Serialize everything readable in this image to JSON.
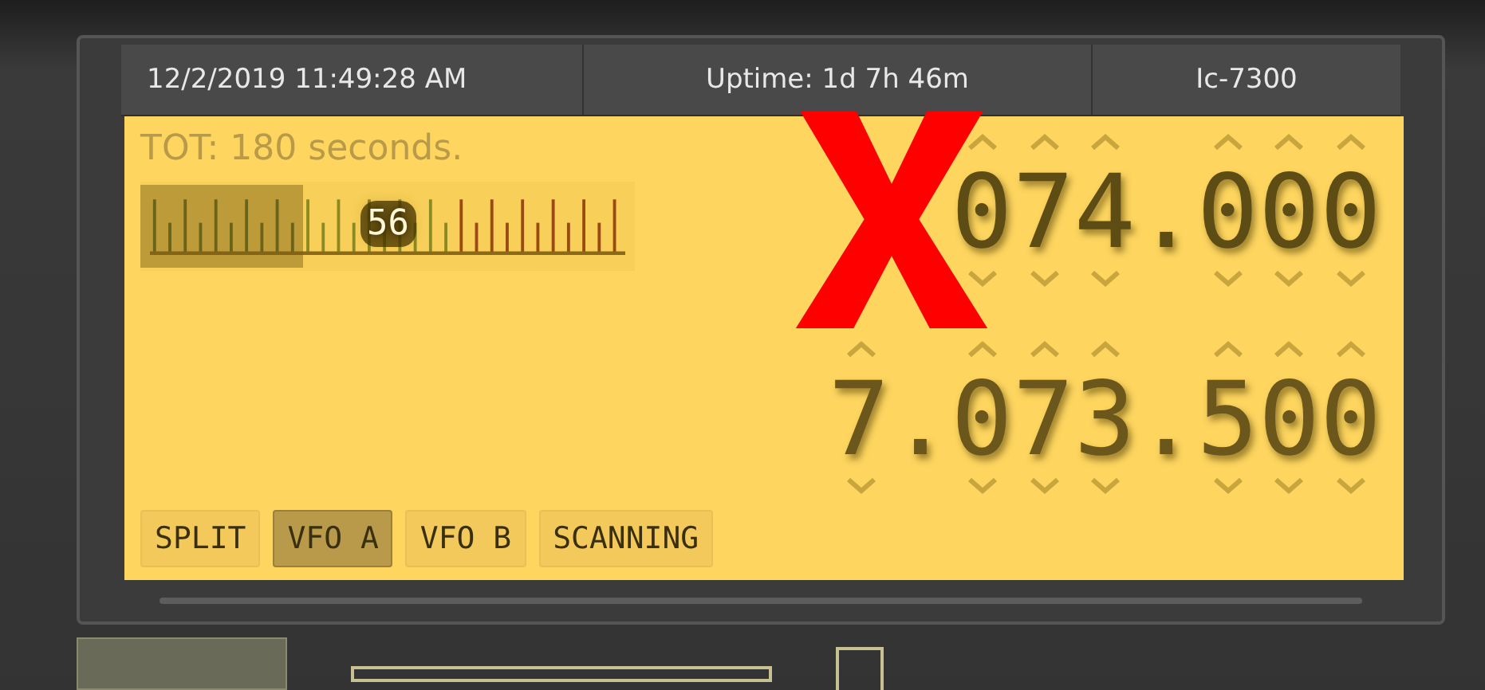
{
  "header": {
    "datetime": "12/2/2019 11:49:28 AM",
    "uptime": "Uptime: 1d 7h 46m",
    "radio": "Ic-7300"
  },
  "tot": "TOT: 180 seconds.",
  "meter": {
    "level": 0.33,
    "reading": "56"
  },
  "frequencies": [
    {
      "kind": "main",
      "value": "074.000"
    },
    {
      "kind": "sub",
      "value": "7.073.500"
    }
  ],
  "buttons": [
    {
      "label": "SPLIT",
      "selected": false
    },
    {
      "label": "VFO A",
      "selected": true
    },
    {
      "label": "VFO B",
      "selected": false
    },
    {
      "label": "SCANNING",
      "selected": false
    }
  ],
  "annotation": {
    "kind": "cross"
  }
}
